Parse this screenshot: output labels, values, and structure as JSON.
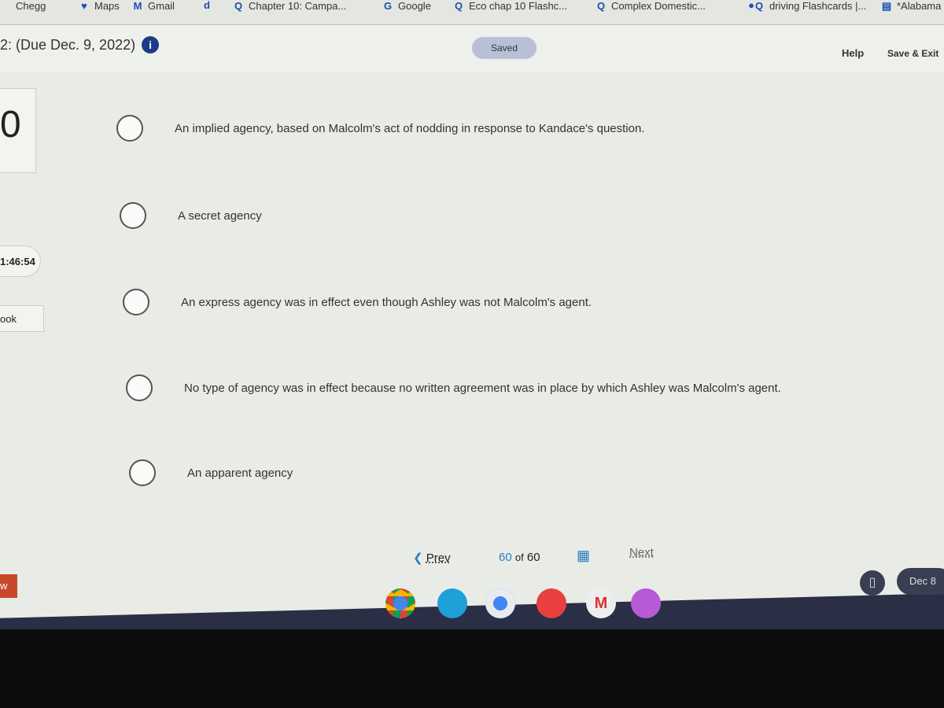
{
  "bookmarks": [
    {
      "label": "Chegg",
      "icon": "chegg-icon"
    },
    {
      "label": "Maps",
      "icon": "maps-pin-icon"
    },
    {
      "label": "Gmail",
      "icon": "gmail-icon"
    },
    {
      "label": "",
      "icon": "d-icon"
    },
    {
      "label": "Chapter 10: Campa...",
      "icon": "quizlet-icon"
    },
    {
      "label": "Google",
      "icon": "google-icon"
    },
    {
      "label": "Eco chap 10 Flashc...",
      "icon": "quizlet-icon"
    },
    {
      "label": "Complex Domestic...",
      "icon": "quizlet-icon"
    },
    {
      "label": "",
      "icon": "globe-icon"
    },
    {
      "label": "driving Flashcards |...",
      "icon": "quizlet-icon"
    },
    {
      "label": "*Alabama",
      "icon": "docs-icon"
    }
  ],
  "header": {
    "title": "2: (Due Dec. 9, 2022)",
    "saved": "Saved",
    "help": "Help",
    "save_exit": "Save & Exit"
  },
  "sidebar": {
    "score": "0",
    "timer": "1:46:54",
    "book": "ook",
    "w": "w"
  },
  "options": [
    "An implied agency, based on Malcolm's act of nodding in response to Kandace's question.",
    "A secret agency",
    "An express agency was in effect even though Ashley was not Malcolm's agent.",
    "No type of agency was in effect because no written agreement was in place by which Ashley was Malcolm's agent.",
    "An apparent agency"
  ],
  "pager": {
    "prev": "Prev",
    "current": "60",
    "of": "of",
    "total": "60",
    "next": "Next"
  },
  "taskbar": {
    "date": "Dec 8",
    "apps": [
      "chrome",
      "files",
      "docs",
      "youtube",
      "gmail",
      "keep"
    ]
  },
  "colors": {
    "accent": "#2a7fc1",
    "info": "#1f3a8a",
    "shelf": "#2b2f45"
  }
}
